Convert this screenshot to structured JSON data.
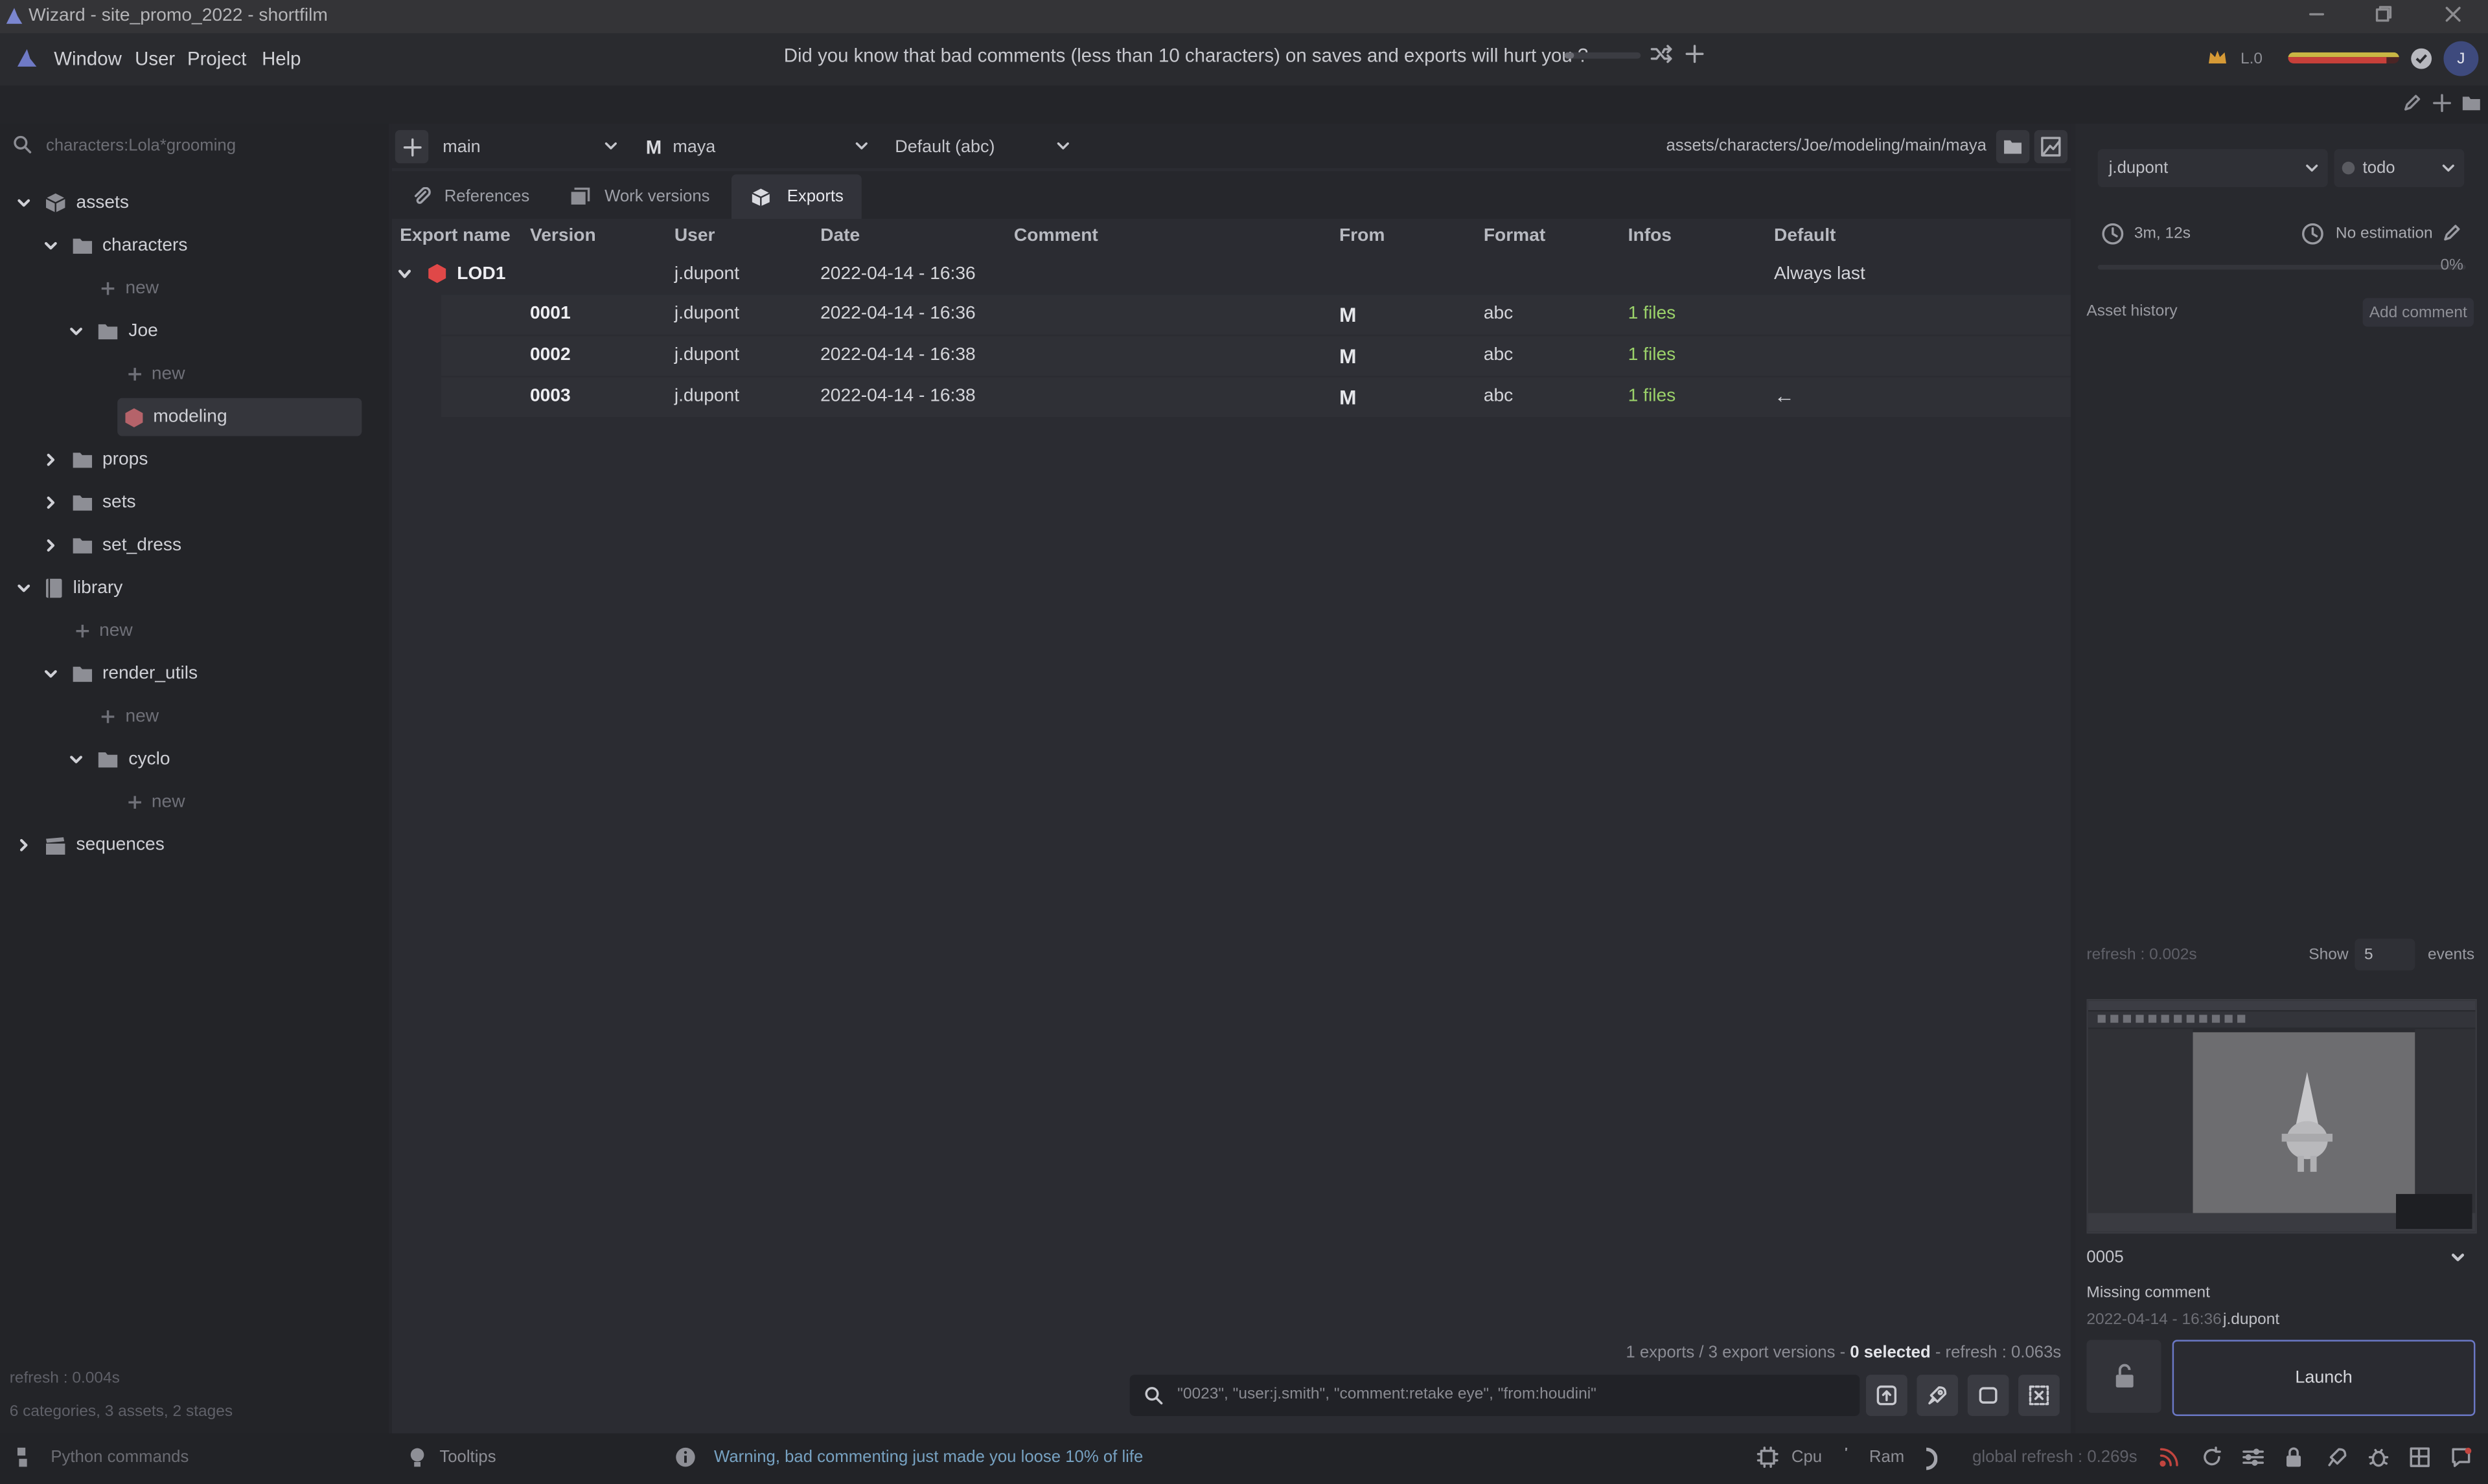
{
  "window": {
    "title": "Wizard - site_promo_2022 - shortfilm"
  },
  "menu": {
    "items": [
      "Window",
      "User",
      "Project",
      "Help"
    ],
    "tip": "Did you know that bad comments (less than 10 characters) on saves and exports will hurt you ?",
    "level": "L.0",
    "avatar": "J"
  },
  "left": {
    "search_placeholder": "characters:Lola*grooming",
    "tree": [
      {
        "label": "assets",
        "icon": "cube-icon",
        "level": 0,
        "expanded": true
      },
      {
        "label": "characters",
        "icon": "folder-icon",
        "level": 1,
        "expanded": true
      },
      {
        "label": "new",
        "icon": "plus-icon",
        "level": 2,
        "new": true
      },
      {
        "label": "Joe",
        "icon": "folder-icon",
        "level": 2,
        "expanded": true
      },
      {
        "label": "new",
        "icon": "plus-icon",
        "level": 3,
        "new": true
      },
      {
        "label": "modeling",
        "icon": "stage-cube-icon",
        "level": 3,
        "selected": true
      },
      {
        "label": "props",
        "icon": "folder-icon",
        "level": 1,
        "expanded": false
      },
      {
        "label": "sets",
        "icon": "folder-icon",
        "level": 1,
        "expanded": false
      },
      {
        "label": "set_dress",
        "icon": "folder-icon",
        "level": 1,
        "expanded": false
      },
      {
        "label": "library",
        "icon": "book-icon",
        "level": 0,
        "expanded": true
      },
      {
        "label": "new",
        "icon": "plus-icon",
        "level": 1,
        "new": true
      },
      {
        "label": "render_utils",
        "icon": "folder-icon",
        "level": 1,
        "expanded": true
      },
      {
        "label": "new",
        "icon": "plus-icon",
        "level": 2,
        "new": true
      },
      {
        "label": "cyclo",
        "icon": "folder-icon",
        "level": 2,
        "expanded": true
      },
      {
        "label": "new",
        "icon": "plus-icon",
        "level": 3,
        "new": true
      },
      {
        "label": "sequences",
        "icon": "clapper-icon",
        "level": 0,
        "expanded": false
      }
    ],
    "refresh": "refresh : 0.004s",
    "summary": "6 categories, 3 assets, 2 stages"
  },
  "center": {
    "variant": "main",
    "software": "maya",
    "export_format": "Default (abc)",
    "path": "assets/characters/Joe/modeling/main/maya",
    "tabs": [
      "References",
      "Work versions",
      "Exports"
    ],
    "active_tab": "Exports",
    "columns": [
      "Export name",
      "Version",
      "User",
      "Date",
      "Comment",
      "From",
      "Format",
      "Infos",
      "Default"
    ],
    "export": {
      "name": "LOD1",
      "user": "j.dupont",
      "date": "2022-04-14 - 16:36",
      "default": "Always last"
    },
    "versions": [
      {
        "version": "0001",
        "user": "j.dupont",
        "date": "2022-04-14 - 16:36",
        "from": "M",
        "format": "abc",
        "infos": "1 files",
        "default": ""
      },
      {
        "version": "0002",
        "user": "j.dupont",
        "date": "2022-04-14 - 16:38",
        "from": "M",
        "format": "abc",
        "infos": "1 files",
        "default": ""
      },
      {
        "version": "0003",
        "user": "j.dupont",
        "date": "2022-04-14 - 16:38",
        "from": "M",
        "format": "abc",
        "infos": "1 files",
        "default": "←"
      }
    ],
    "footer": {
      "pre": "1 exports / 3 export versions - ",
      "selected": "0 selected",
      "post": " - refresh : 0.063s"
    },
    "search_placeholder": "\"0023\", \"user:j.smith\", \"comment:retake eye\", \"from:houdini\""
  },
  "right": {
    "user": "j.dupont",
    "state": "todo",
    "work_time": "3m, 12s",
    "estimation": "No estimation",
    "progress": 0,
    "progress_label": "0%",
    "history_label": "Asset history",
    "add_comment": "Add comment",
    "refresh": "refresh : 0.002s",
    "show_label": "Show",
    "show_count": "5",
    "events_label": "events",
    "version": "0005",
    "comment": "Missing comment",
    "date": "2022-04-14 - 16:36",
    "date_user": "j.dupont",
    "launch": "Launch"
  },
  "status": {
    "python": "Python commands",
    "tooltips": "Tooltips",
    "warning": "Warning, bad commenting just made you loose 10% of life",
    "cpu": "Cpu",
    "ram": "Ram",
    "global_refresh": "global refresh : 0.269s"
  },
  "colors": {
    "accent": "#6b78c6",
    "info_green": "#9bd26a",
    "export_red": "#e04848"
  }
}
